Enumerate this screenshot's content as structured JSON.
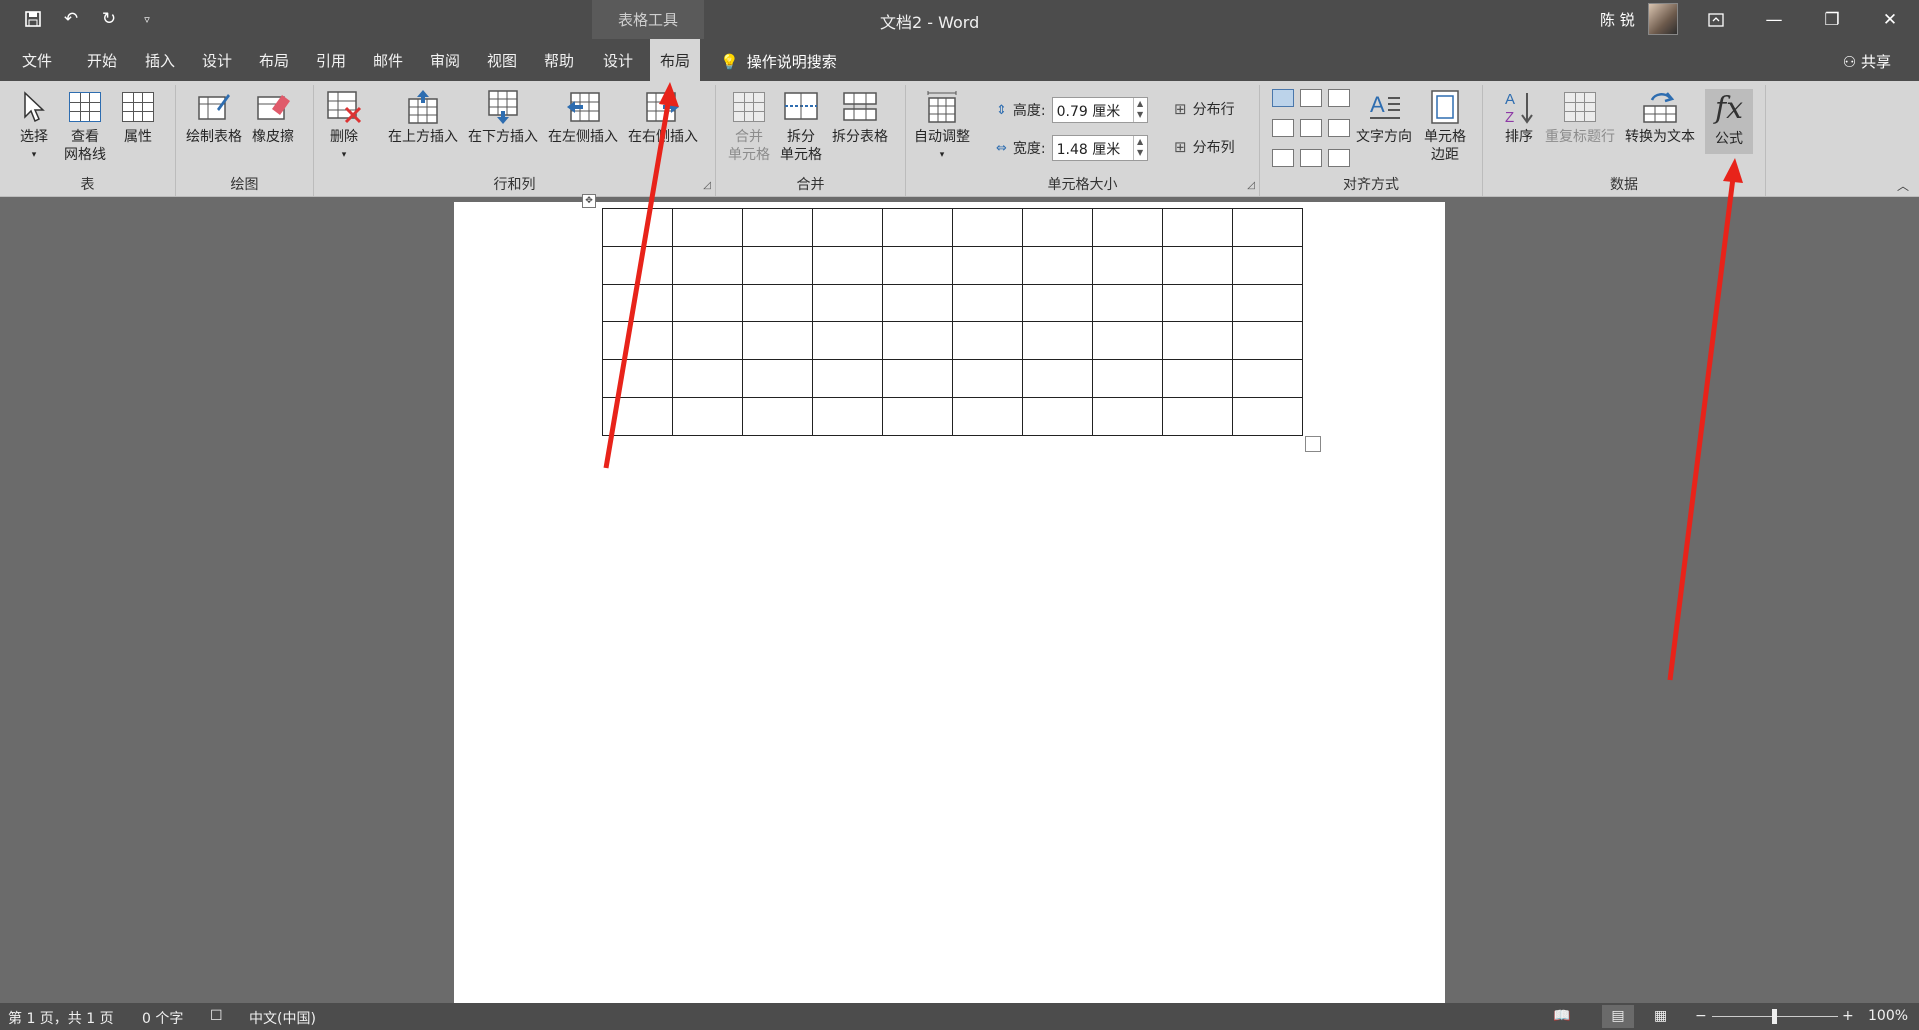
{
  "titlebar": {
    "qat": {
      "save_icon": "save-icon",
      "undo_icon": "undo-icon",
      "redo_icon": "redo-icon",
      "customize_icon": "chevron-down-icon"
    },
    "context_label": "表格工具",
    "title": "文档2  -  Word",
    "user": "陈 锐",
    "window_buttons": {
      "ribbon_display": "ribbon-display-icon",
      "minimize": "—",
      "restore": "❐",
      "close": "✕"
    }
  },
  "tabs": [
    {
      "label": "文件"
    },
    {
      "label": "开始"
    },
    {
      "label": "插入"
    },
    {
      "label": "设计"
    },
    {
      "label": "布局"
    },
    {
      "label": "引用"
    },
    {
      "label": "邮件"
    },
    {
      "label": "审阅"
    },
    {
      "label": "视图"
    },
    {
      "label": "帮助"
    },
    {
      "label": "设计"
    },
    {
      "label": "布局",
      "active": true
    }
  ],
  "tellme": "操作说明搜索",
  "share": "共享",
  "ribbon": {
    "table": {
      "label": "表",
      "select": "选择",
      "view_grid_1": "查看",
      "view_grid_2": "网格线",
      "properties": "属性"
    },
    "draw": {
      "label": "绘图",
      "draw_table": "绘制表格",
      "eraser": "橡皮擦"
    },
    "rows_cols": {
      "label": "行和列",
      "delete": "删除",
      "insert_above": "在上方插入",
      "insert_below": "在下方插入",
      "insert_left": "在左侧插入",
      "insert_right": "在右侧插入"
    },
    "merge": {
      "label": "合并",
      "merge_cells_1": "合并",
      "merge_cells_2": "单元格",
      "split_cells_1": "拆分",
      "split_cells_2": "单元格",
      "split_table": "拆分表格"
    },
    "cell_size": {
      "label": "单元格大小",
      "autofit": "自动调整",
      "height_label": "高度:",
      "height_value": "0.79 厘米",
      "width_label": "宽度:",
      "width_value": "1.48 厘米",
      "distribute_rows": "分布行",
      "distribute_cols": "分布列"
    },
    "alignment": {
      "label": "对齐方式",
      "text_direction": "文字方向",
      "cell_margins_1": "单元格",
      "cell_margins_2": "边距"
    },
    "data": {
      "label": "数据",
      "sort": "排序",
      "repeat_header": "重复标题行",
      "convert_text": "转换为文本",
      "formula": "公式",
      "formula_glyph": "fx"
    }
  },
  "document": {
    "table_rows": 6,
    "table_cols": 10
  },
  "statusbar": {
    "page": "第 1 页，共 1 页",
    "words": "0 个字",
    "language": "中文(中国)",
    "zoom": "100%"
  },
  "annotations": {
    "arrow_color": "#e8231a"
  }
}
